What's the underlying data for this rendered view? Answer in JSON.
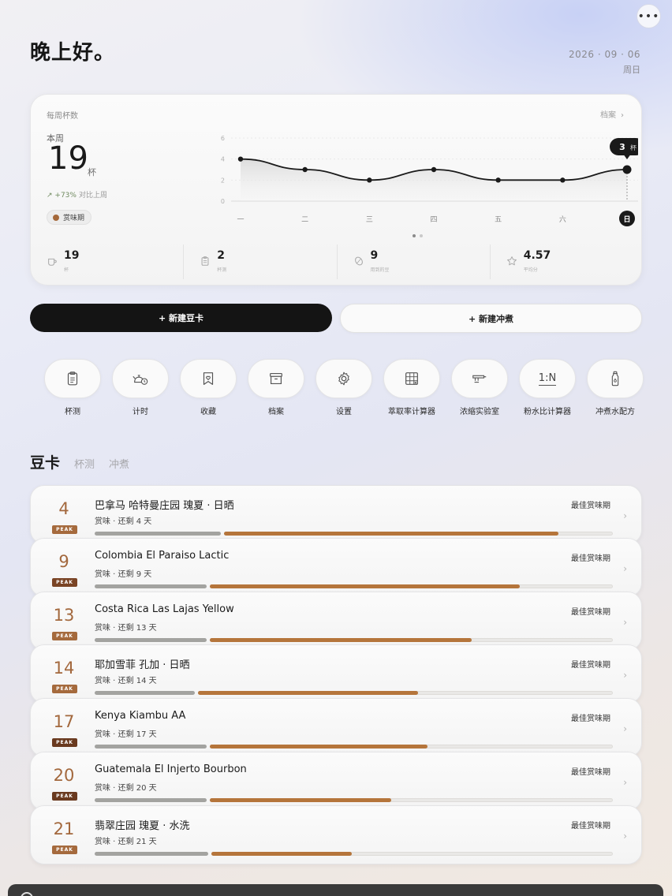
{
  "header": {
    "greeting": "晚上好。",
    "date": "2026 · 09 · 06",
    "weekday": "周日",
    "more_icon": "more-icon"
  },
  "weekly": {
    "title": "每周杯数",
    "archive_link": "档案",
    "week_label": "本周",
    "count": "19",
    "unit": "杯",
    "trend": "+73%",
    "trend_compare": "对比上周",
    "season_chip": "赏味期",
    "tooltip_value": "3",
    "tooltip_unit": "杯",
    "stats": [
      {
        "icon": "cup-icon",
        "value": "19",
        "label": "杯"
      },
      {
        "icon": "clipboard-icon",
        "value": "2",
        "label": "杯测"
      },
      {
        "icon": "bean-icon",
        "value": "9",
        "label": "用到的豆"
      },
      {
        "icon": "star-icon",
        "value": "4.57",
        "label": "平均分"
      }
    ]
  },
  "chart_data": {
    "type": "area",
    "categories": [
      "一",
      "二",
      "三",
      "四",
      "五",
      "六",
      "日"
    ],
    "values": [
      4,
      3,
      2,
      3,
      2,
      2,
      3
    ],
    "ylim": [
      0,
      6
    ],
    "yticks": [
      0,
      2,
      4,
      6
    ],
    "highlight_index": 6,
    "grid": true
  },
  "actions": {
    "new_bean": "+ 新建豆卡",
    "new_brew": "+ 新建冲煮"
  },
  "tools": [
    {
      "label": "杯测",
      "icon": "clipboard-icon"
    },
    {
      "label": "计时",
      "icon": "kettle-timer-icon"
    },
    {
      "label": "收藏",
      "icon": "bookmark-heart-icon"
    },
    {
      "label": "档案",
      "icon": "archive-box-icon"
    },
    {
      "label": "设置",
      "icon": "gear-icon"
    },
    {
      "label": "萃取率计算器",
      "icon": "calculator-grid-icon"
    },
    {
      "label": "浓缩实验室",
      "icon": "espresso-machine-icon"
    },
    {
      "label": "粉水比计算器",
      "icon": "ratio-icon",
      "glyph": "1:N"
    },
    {
      "label": "冲煮水配方",
      "icon": "water-bottle-icon"
    }
  ],
  "tabs": {
    "active": "豆卡",
    "others": [
      "杯测",
      "冲煮"
    ]
  },
  "beans": [
    {
      "days": "4",
      "badge": "PEAK",
      "name": "巴拿马 哈特曼庄园 瑰夏 · 日晒",
      "status": "赏味 · 还剩 4 天",
      "best": "最佳赏味期",
      "progress": 0.86
    },
    {
      "days": "9",
      "badge": "PEAK",
      "name": "Colombia El Paraiso Lactic",
      "status": "赏味 · 还剩 9 天",
      "best": "最佳赏味期",
      "progress": 0.77
    },
    {
      "days": "13",
      "badge": "PEAK",
      "name": "Costa Rica Las Lajas Yellow",
      "status": "赏味 · 还剩 13 天",
      "best": "最佳赏味期",
      "progress": 0.65
    },
    {
      "days": "14",
      "badge": "PEAK",
      "name": "耶加雪菲 孔加 · 日晒",
      "status": "赏味 · 还剩 14 天",
      "best": "最佳赏味期",
      "progress": 0.53
    },
    {
      "days": "17",
      "badge": "PEAK",
      "name": "Kenya Kiambu AA",
      "status": "赏味 · 还剩 17 天",
      "best": "最佳赏味期",
      "progress": 0.54
    },
    {
      "days": "20",
      "badge": "PEAK",
      "name": "Guatemala El Injerto Bourbon",
      "status": "赏味 · 还剩 20 天",
      "best": "最佳赏味期",
      "progress": 0.45
    },
    {
      "days": "21",
      "badge": "PEAK",
      "name": "翡翠庄园 瑰夏 · 水洗",
      "status": "赏味 · 还剩 21 天",
      "best": "最佳赏味期",
      "progress": 0.35
    }
  ],
  "colors": {
    "accent_brown": "#b5753b",
    "badge_brown_light": "#a56a3d",
    "badge_brown_dark": "#6a3a1f",
    "primary_black": "#141414"
  }
}
